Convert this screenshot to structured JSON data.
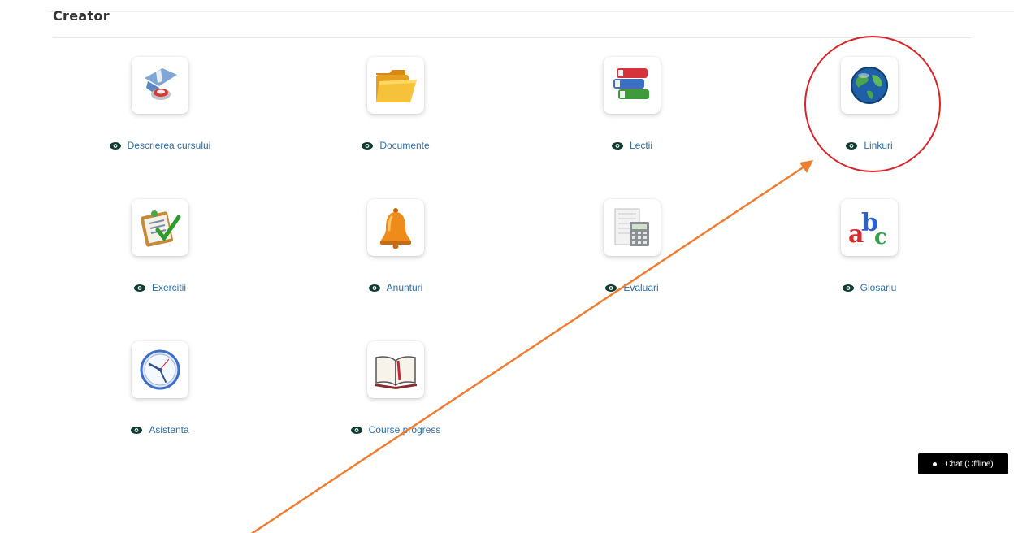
{
  "section": {
    "title": "Creator"
  },
  "tools": [
    {
      "label": "Descrierea cursului",
      "icon": "course-description-icon"
    },
    {
      "label": "Documente",
      "icon": "folder-icon"
    },
    {
      "label": "Lectii",
      "icon": "books-icon"
    },
    {
      "label": "Linkuri",
      "icon": "globe-icon"
    },
    {
      "label": "Exercitii",
      "icon": "checklist-icon"
    },
    {
      "label": "Anunturi",
      "icon": "bell-icon"
    },
    {
      "label": "Evaluari",
      "icon": "calculator-icon"
    },
    {
      "label": "Glosariu",
      "icon": "abc-icon"
    },
    {
      "label": "Asistenta",
      "icon": "clock-icon"
    },
    {
      "label": "Course progress",
      "icon": "open-book-icon"
    }
  ],
  "chat": {
    "label": "Chat (Offline)"
  },
  "colors": {
    "link": "#2e6da4",
    "annotation_circle": "#d8232a",
    "annotation_arrow": "#ed7d31"
  }
}
